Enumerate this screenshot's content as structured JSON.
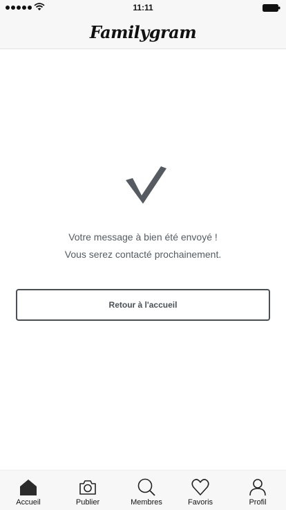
{
  "status_bar": {
    "time": "11:11"
  },
  "header": {
    "logo_text": "Familygram"
  },
  "confirmation": {
    "line1": "Votre message à bien été envoyé !",
    "line2": "Vous serez contacté prochainement."
  },
  "actions": {
    "home_button_label": "Retour à l'accueil"
  },
  "tabbar": {
    "items": [
      {
        "label": "Accueil",
        "icon": "home-icon"
      },
      {
        "label": "Publier",
        "icon": "camera-icon"
      },
      {
        "label": "Membres",
        "icon": "search-icon"
      },
      {
        "label": "Favoris",
        "icon": "heart-icon"
      },
      {
        "label": "Profil",
        "icon": "user-icon"
      }
    ]
  },
  "colors": {
    "primary": "#4a4f55",
    "bar_background": "#f7f7f7"
  }
}
